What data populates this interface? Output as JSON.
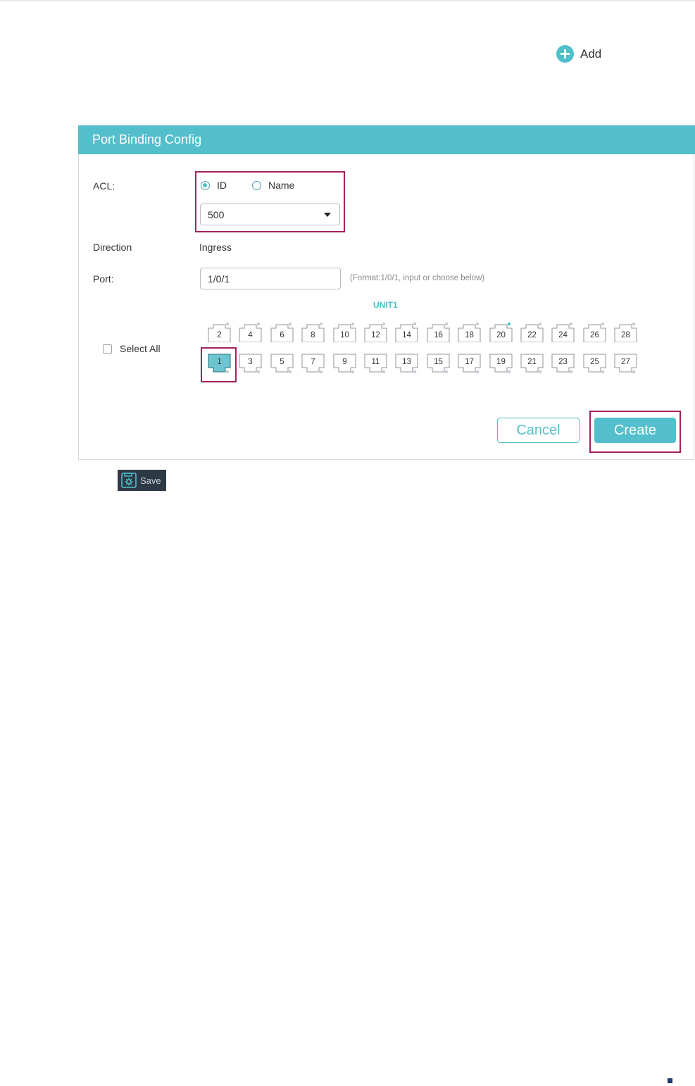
{
  "toolbar": {
    "add_label": "Add",
    "save_label": "Save"
  },
  "panel": {
    "title": "Port Binding Config",
    "acl_label": "ACL:",
    "acl_mode_options": [
      "ID",
      "Name"
    ],
    "acl_mode_selected": "ID",
    "acl_value": "500",
    "direction_label": "Direction",
    "direction_value": "Ingress",
    "port_label": "Port:",
    "port_value": "1/0/1",
    "port_hint": "(Format:1/0/1, input or choose below)",
    "unit_label": "UNIT1",
    "select_all_label": "Select All",
    "ports_top": [
      "2",
      "4",
      "6",
      "8",
      "10",
      "12",
      "14",
      "16",
      "18",
      "20",
      "22",
      "24",
      "26",
      "28"
    ],
    "ports_bottom": [
      "1",
      "3",
      "5",
      "7",
      "9",
      "11",
      "13",
      "15",
      "17",
      "19",
      "21",
      "23",
      "25",
      "27"
    ],
    "selected_port": "1",
    "cancel_label": "Cancel",
    "create_label": "Create"
  },
  "colors": {
    "accent": "#54bfcc",
    "highlight": "#a3235a",
    "save_bg": "#2d3a45"
  },
  "icons": {
    "add": "plus-circle-icon",
    "save": "save-gear-icon",
    "dropdown": "caret-down-icon"
  }
}
